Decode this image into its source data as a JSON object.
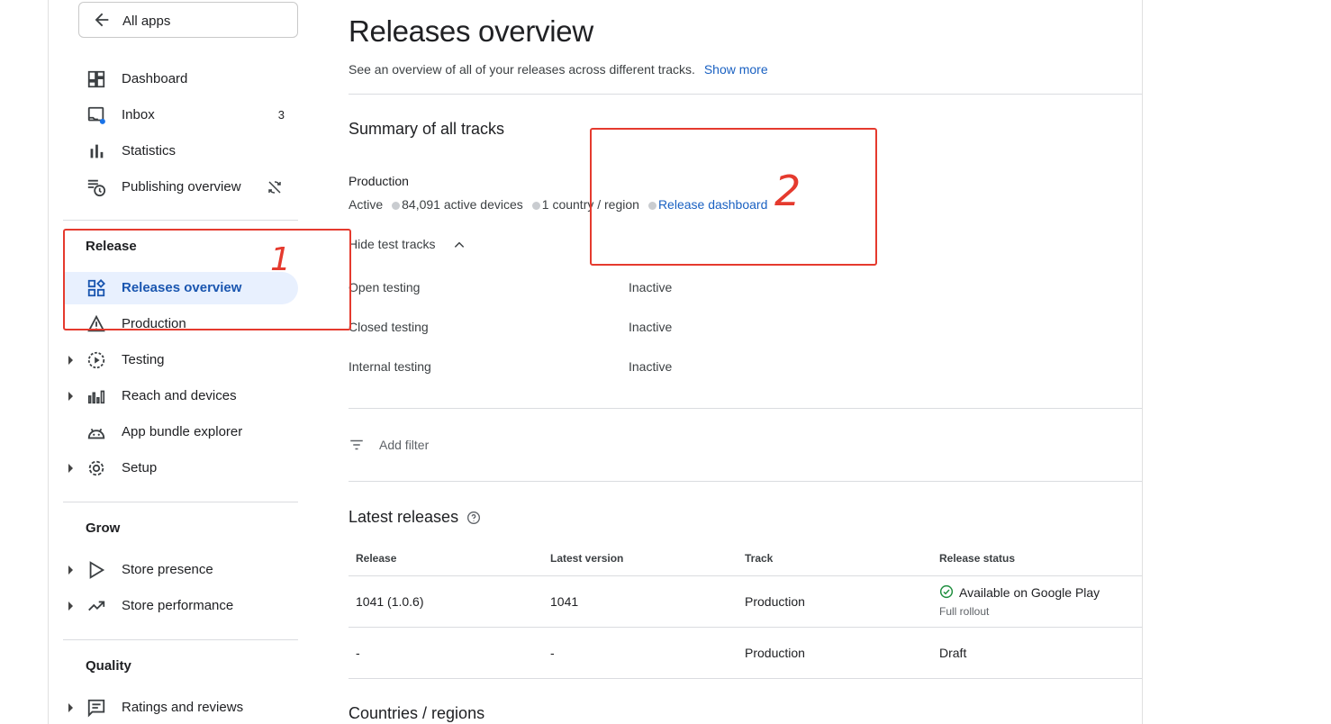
{
  "sidebar": {
    "back_label": "All apps",
    "items": [
      {
        "label": "Dashboard",
        "icon": "dashboard-icon"
      },
      {
        "label": "Inbox",
        "icon": "inbox-icon",
        "badge": "3"
      },
      {
        "label": "Statistics",
        "icon": "bar-chart-icon"
      },
      {
        "label": "Publishing overview",
        "icon": "schedule-list-icon"
      }
    ],
    "release_section": "Release",
    "release_items": [
      {
        "label": "Releases overview",
        "icon": "grid-icon"
      },
      {
        "label": "Production",
        "icon": "warning-icon"
      },
      {
        "label": "Testing",
        "icon": "play-circle-icon"
      },
      {
        "label": "Reach and devices",
        "icon": "bar-chart-icon"
      },
      {
        "label": "App bundle explorer",
        "icon": "android-icon"
      },
      {
        "label": "Setup",
        "icon": "gear-icon"
      }
    ],
    "grow_section": "Grow",
    "grow_items": [
      {
        "label": "Store presence",
        "icon": "play-icon"
      },
      {
        "label": "Store performance",
        "icon": "trend-icon"
      }
    ],
    "quality_section": "Quality",
    "quality_items": [
      {
        "label": "Ratings and reviews",
        "icon": "review-icon"
      }
    ]
  },
  "main": {
    "title": "Releases overview",
    "subtitle": "See an overview of all of your releases across different tracks.",
    "show_more": "Show more",
    "summary_title": "Summary of all tracks",
    "production": {
      "label": "Production",
      "status": "Active",
      "devices": "84,091 active devices",
      "countries": "1 country / region",
      "dashboard_link": "Release dashboard"
    },
    "hide_test_tracks": "Hide test tracks",
    "test_tracks": [
      {
        "name": "Open testing",
        "status": "Inactive"
      },
      {
        "name": "Closed testing",
        "status": "Inactive"
      },
      {
        "name": "Internal testing",
        "status": "Inactive"
      }
    ],
    "add_filter": "Add filter",
    "latest_releases_title": "Latest releases",
    "table": {
      "headers": [
        "Release",
        "Latest version",
        "Track",
        "Release status"
      ],
      "rows": [
        {
          "release": "1041 (1.0.6)",
          "version": "1041",
          "track": "Production",
          "status": "Available on Google Play",
          "status_sub": "Full rollout"
        },
        {
          "release": "-",
          "version": "-",
          "track": "Production",
          "status": "Draft",
          "status_sub": ""
        }
      ]
    },
    "countries_title": "Countries / regions"
  },
  "annotations": {
    "mark_1": "1",
    "mark_2": "2"
  },
  "colors": {
    "accent": "#1a61c2",
    "active_bg": "#e8f0fe",
    "annotation": "#e53a2e",
    "success": "#1e8e3e"
  }
}
